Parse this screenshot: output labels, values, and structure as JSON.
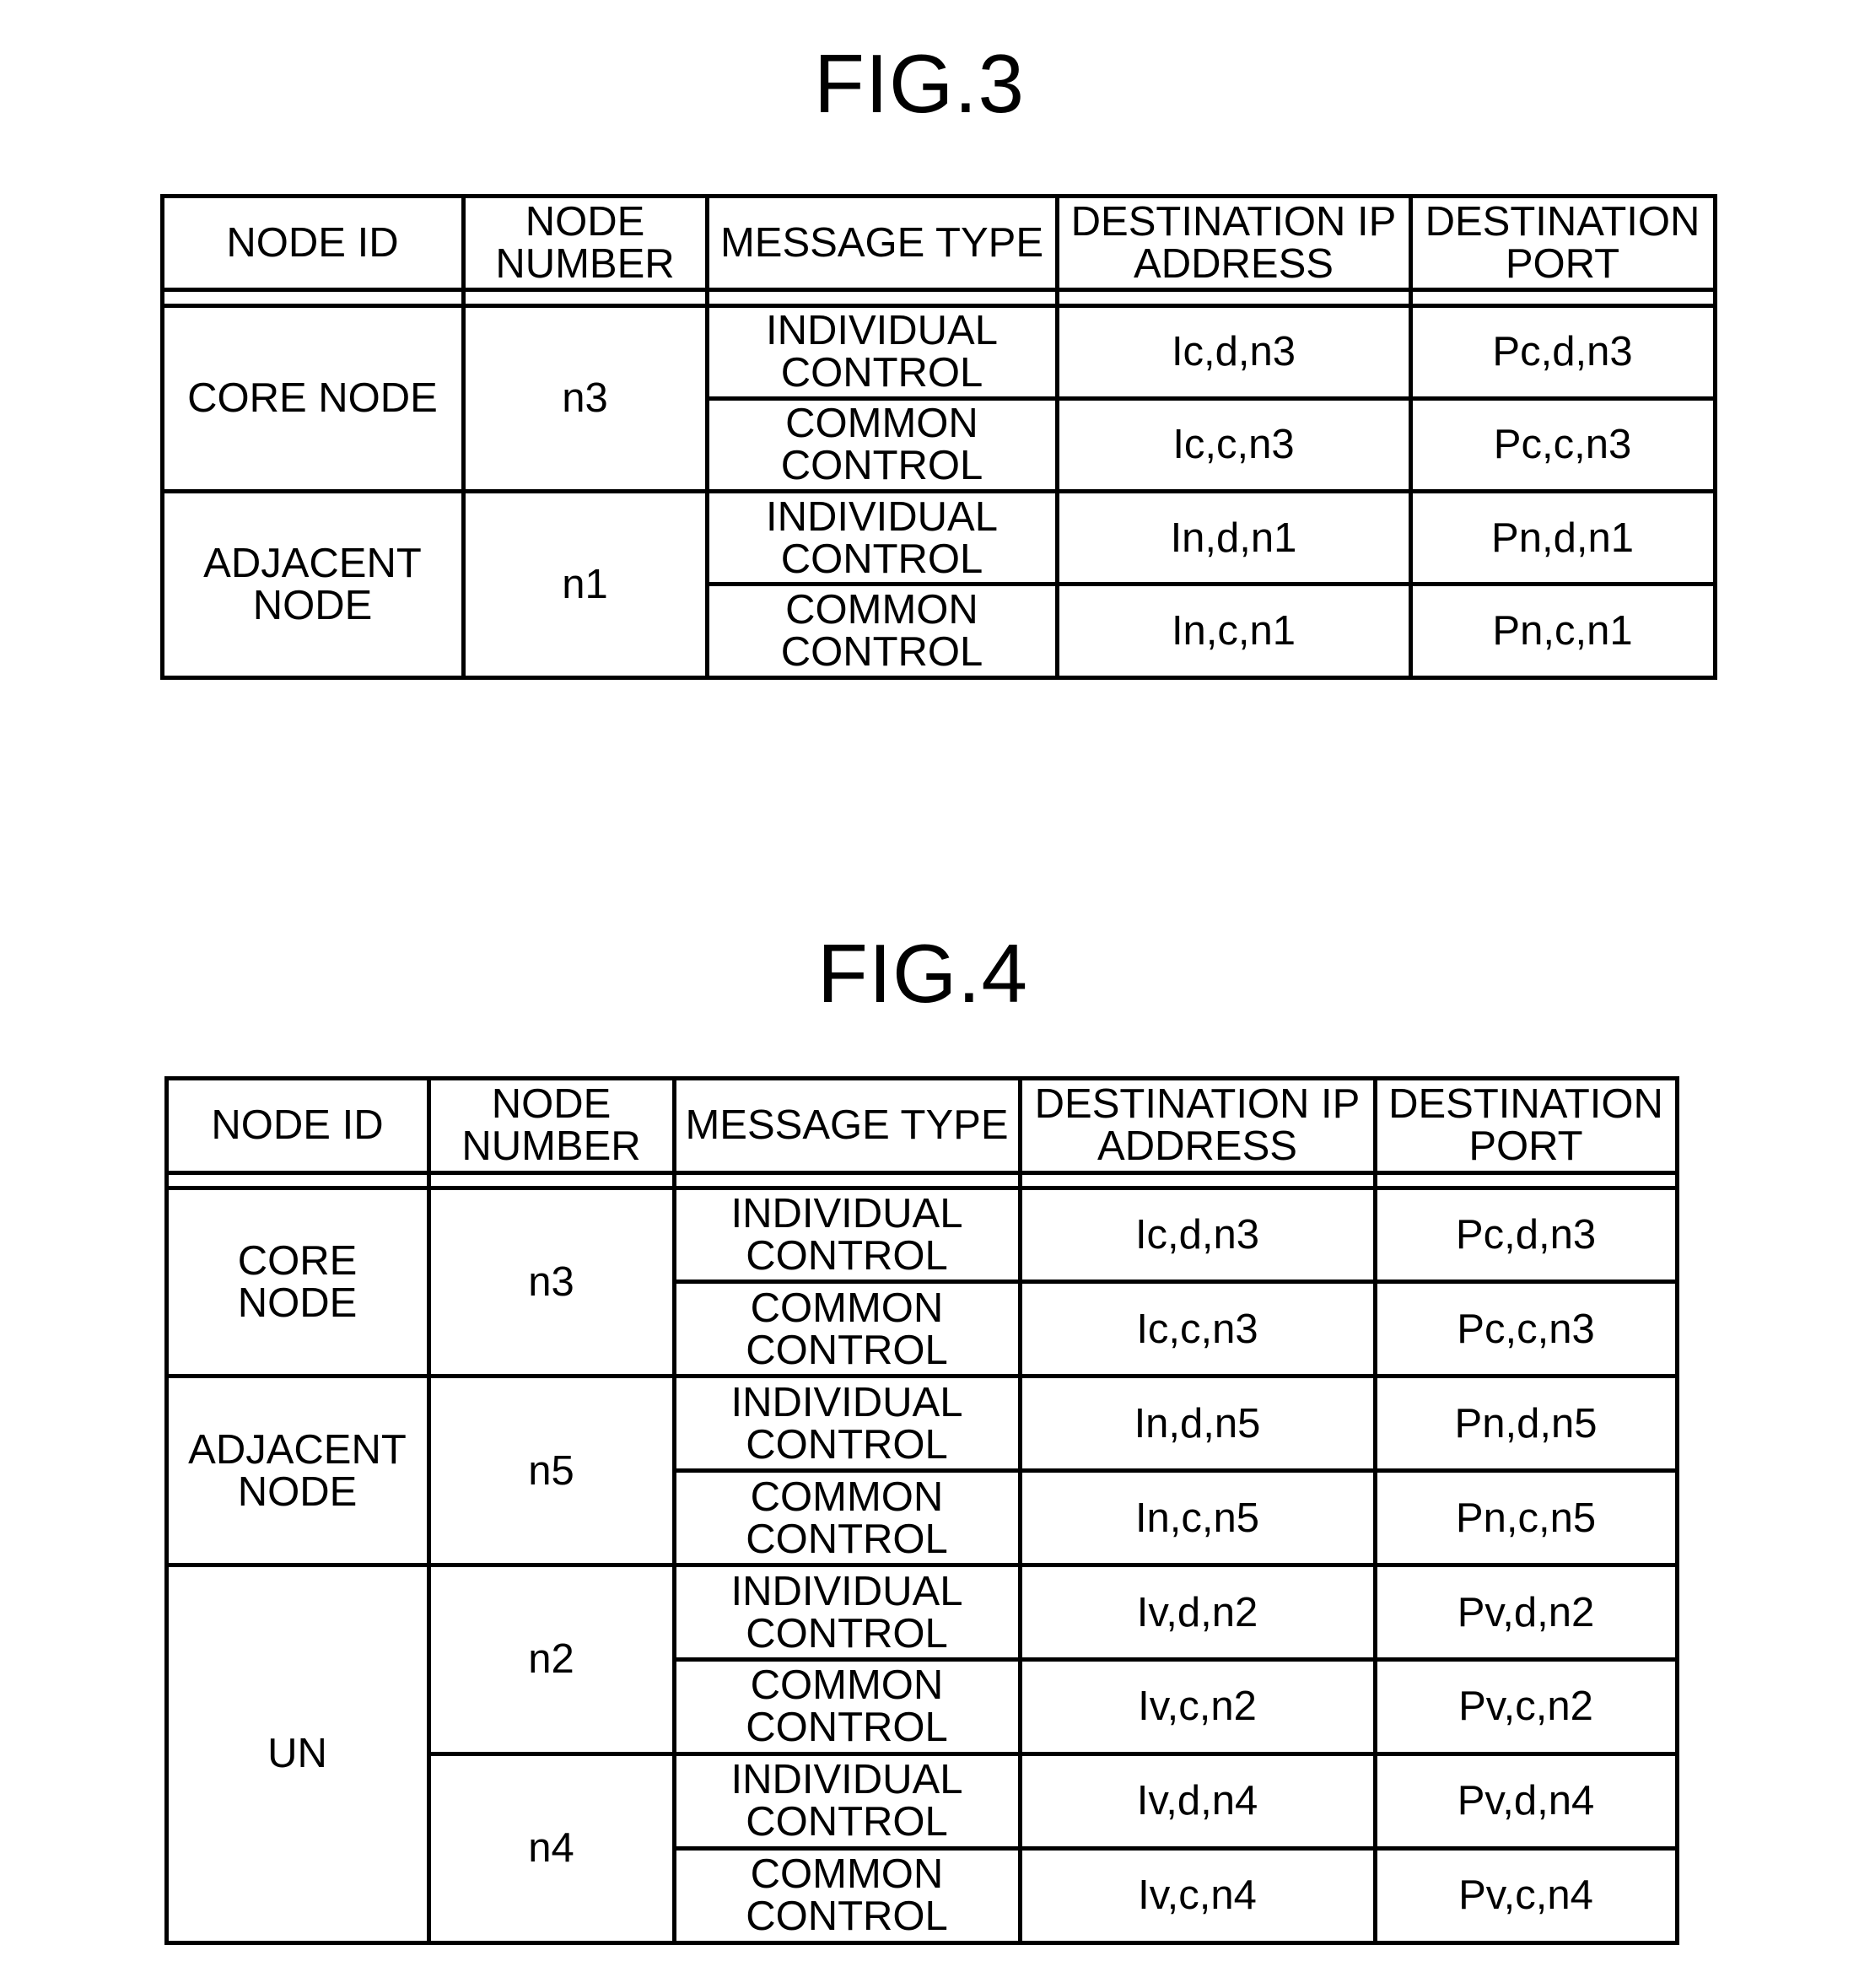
{
  "figures": [
    {
      "title": "FIG.3",
      "columns": [
        "NODE ID",
        "NODE\nNUMBER",
        "MESSAGE TYPE",
        "DESTINATION IP\nADDRESS",
        "DESTINATION\nPORT"
      ],
      "groups": [
        {
          "node_id": "CORE NODE",
          "nodes": [
            {
              "node_number": "n3",
              "rows": [
                {
                  "message_type": "INDIVIDUAL\nCONTROL",
                  "dest_ip": "Ic,d,n3",
                  "dest_port": "Pc,d,n3"
                },
                {
                  "message_type": "COMMON\nCONTROL",
                  "dest_ip": "Ic,c,n3",
                  "dest_port": "Pc,c,n3"
                }
              ]
            }
          ]
        },
        {
          "node_id": "ADJACENT\nNODE",
          "nodes": [
            {
              "node_number": "n1",
              "rows": [
                {
                  "message_type": "INDIVIDUAL\nCONTROL",
                  "dest_ip": "In,d,n1",
                  "dest_port": "Pn,d,n1"
                },
                {
                  "message_type": "COMMON\nCONTROL",
                  "dest_ip": "In,c,n1",
                  "dest_port": "Pn,c,n1"
                }
              ]
            }
          ]
        }
      ]
    },
    {
      "title": "FIG.4",
      "columns": [
        "NODE ID",
        "NODE\nNUMBER",
        "MESSAGE TYPE",
        "DESTINATION IP\nADDRESS",
        "DESTINATION\nPORT"
      ],
      "groups": [
        {
          "node_id": "CORE\nNODE",
          "nodes": [
            {
              "node_number": "n3",
              "rows": [
                {
                  "message_type": "INDIVIDUAL\nCONTROL",
                  "dest_ip": "Ic,d,n3",
                  "dest_port": "Pc,d,n3"
                },
                {
                  "message_type": "COMMON\nCONTROL",
                  "dest_ip": "Ic,c,n3",
                  "dest_port": "Pc,c,n3"
                }
              ]
            }
          ]
        },
        {
          "node_id": "ADJACENT\nNODE",
          "nodes": [
            {
              "node_number": "n5",
              "rows": [
                {
                  "message_type": "INDIVIDUAL\nCONTROL",
                  "dest_ip": "In,d,n5",
                  "dest_port": "Pn,d,n5"
                },
                {
                  "message_type": "COMMON\nCONTROL",
                  "dest_ip": "In,c,n5",
                  "dest_port": "Pn,c,n5"
                }
              ]
            }
          ]
        },
        {
          "node_id": "UN",
          "nodes": [
            {
              "node_number": "n2",
              "rows": [
                {
                  "message_type": "INDIVIDUAL\nCONTROL",
                  "dest_ip": "Iv,d,n2",
                  "dest_port": "Pv,d,n2"
                },
                {
                  "message_type": "COMMON\nCONTROL",
                  "dest_ip": "Iv,c,n2",
                  "dest_port": "Pv,c,n2"
                }
              ]
            },
            {
              "node_number": "n4",
              "rows": [
                {
                  "message_type": "INDIVIDUAL\nCONTROL",
                  "dest_ip": "Iv,d,n4",
                  "dest_port": "Pv,d,n4"
                },
                {
                  "message_type": "COMMON\nCONTROL",
                  "dest_ip": "Iv,c,n4",
                  "dest_port": "Pv,c,n4"
                }
              ]
            }
          ]
        }
      ]
    }
  ]
}
